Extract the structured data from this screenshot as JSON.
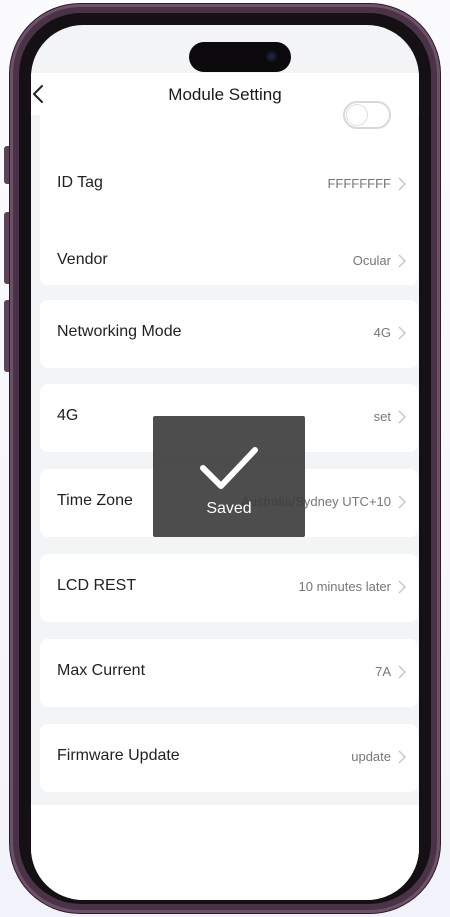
{
  "header": {
    "title": "Module Setting"
  },
  "settings": {
    "id_tag": {
      "label": "ID Tag",
      "value": "FFFFFFFF"
    },
    "vendor": {
      "label": "Vendor",
      "value": "Ocular"
    },
    "networking_mode": {
      "label": "Networking Mode",
      "value": "4G"
    },
    "four_g": {
      "label": "4G",
      "value": "set"
    },
    "time_zone": {
      "label": "Time Zone",
      "value": "Australia/Sydney UTC+10"
    },
    "lcd_rest": {
      "label": "LCD REST",
      "value": "10 minutes later"
    },
    "max_current": {
      "label": "Max Current",
      "value": "7A"
    },
    "firmware_update": {
      "label": "Firmware Update",
      "value": "update"
    }
  },
  "toast": {
    "text": "Saved"
  },
  "icons": {
    "back": "chevron-left-icon",
    "row_arrow": "chevron-right-icon",
    "toast": "checkmark-icon"
  },
  "colors": {
    "frame": "#4a3347",
    "background": "#f3f4f6",
    "card": "#ffffff",
    "toast": "#3a3a3a"
  }
}
